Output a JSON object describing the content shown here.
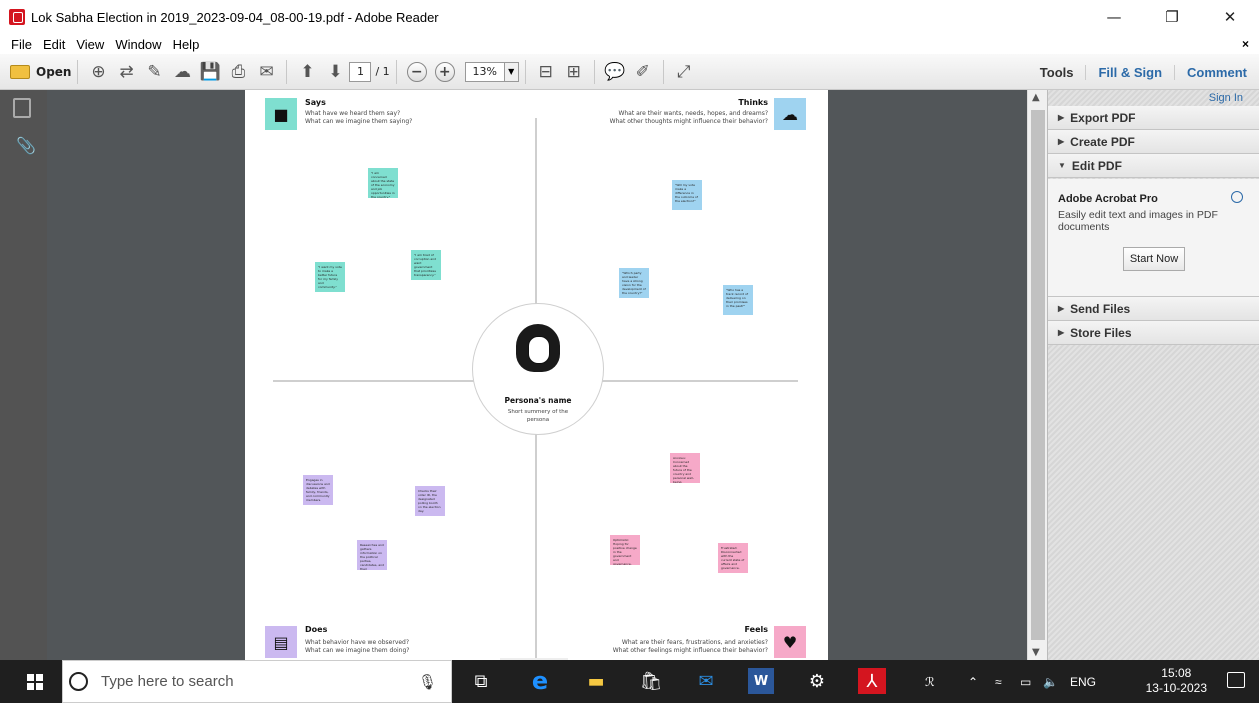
{
  "window": {
    "title": "Lok Sabha Election in 2019_2023-09-04_08-00-19.pdf - Adobe Reader",
    "minimize": "—",
    "restore": "❐",
    "close": "✕"
  },
  "menu": {
    "items": [
      "File",
      "Edit",
      "View",
      "Window",
      "Help"
    ],
    "close_doc": "×"
  },
  "toolbar": {
    "open_label": "Open",
    "page_current": "1",
    "page_total": "/ 1",
    "zoom_minus": "−",
    "zoom_plus": "+",
    "zoom_value": "13%",
    "zoom_dropdown": "▼",
    "tools_label": "Tools",
    "fill_sign_label": "Fill & Sign",
    "comment_label": "Comment",
    "icons": [
      "create-pdf-icon",
      "convert-icon",
      "edit-icon",
      "upload-icon",
      "save-icon",
      "print-icon",
      "email-icon",
      "prev-page-icon",
      "next-page-icon",
      "fit-page-icon",
      "fit-width-icon",
      "comment-icon",
      "highlight-icon",
      "fullscreen-icon"
    ],
    "glyphs": {
      "create": "⊕",
      "convert": "⇄",
      "edit": "✎",
      "upload": "☁",
      "save": "💾",
      "print": "⎙",
      "email": "✉",
      "prev": "⬆",
      "next": "⬇",
      "fitpage": "⊟",
      "fitwidth": "⊞",
      "comment": "💬",
      "highlight": "✐",
      "fullscreen": "⤢"
    }
  },
  "document": {
    "says": {
      "title": "Says",
      "sub1": "What have we heard them say?",
      "sub2": "What can we imagine them saying?"
    },
    "thinks": {
      "title": "Thinks",
      "sub1": "What are their wants, needs, hopes, and dreams?",
      "sub2": "What other thoughts might influence their behavior?"
    },
    "does": {
      "title": "Does",
      "sub1": "What behavior have we observed?",
      "sub2": "What can we imagine them doing?"
    },
    "feels": {
      "title": "Feels",
      "sub1": "What are their fears, frustrations, and anxieties?",
      "sub2": "What other feelings might influence their behavior?"
    },
    "persona": {
      "name": "Persona's name",
      "summary": "Short summery of the persona"
    },
    "notes": {
      "says1": "\"I am concerned about the state of the economy and job opportunities in the country.\"",
      "says2": "\"I want my vote to make a better future for my family and community.\"",
      "says3": "\"I am tired of corruption and want government that prioritizes transparency.\"",
      "thinks1": "\"Will my vote make a difference in the outcome of the election?\"",
      "thinks2": "\"Which party and leader have a strong vision for the development of the country?\"",
      "thinks3": "\"Who has a track record of delivering on their promises in the past?\"",
      "does1": "Engages in discussions and debates with family, friends, and community members.",
      "does2": "Checks their voter ID, the designated polling booth on the election day.",
      "does3": "Researches and gathers information on the political parties, candidates, and their background.",
      "feels1": "Anxious: Concerned about the future of the country and personal well-being.",
      "feels2": "Optimistic: Hoping for positive change in the government and governance.",
      "feels3": "Frustrated: Disconnected with the current state of affairs and governance."
    },
    "colors": {
      "teal": "#7fdfd0",
      "blue": "#9fd3f0",
      "purple": "#cbb9f0",
      "pink": "#f6a9c8"
    }
  },
  "right_panel": {
    "sign_in": "Sign In",
    "export_pdf": "Export PDF",
    "create_pdf": "Create PDF",
    "edit_pdf": "Edit PDF",
    "pro_title": "Adobe Acrobat Pro",
    "pro_desc": "Easily edit text and images in PDF documents",
    "start_now": "Start Now",
    "send_files": "Send Files",
    "store_files": "Store Files"
  },
  "taskbar": {
    "search_placeholder": "Type here to search",
    "lang": "ENG",
    "time": "15:08",
    "date": "13-10-2023"
  }
}
